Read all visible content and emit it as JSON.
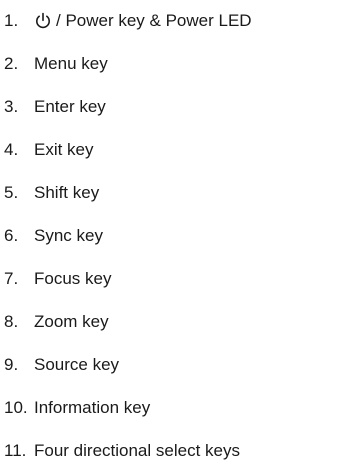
{
  "key_list": {
    "items": [
      {
        "number": "1.",
        "icon": "power-icon",
        "label": "/ Power key & Power LED"
      },
      {
        "number": "2.",
        "label": "Menu key"
      },
      {
        "number": "3.",
        "label": "Enter key"
      },
      {
        "number": "4.",
        "label": "Exit key"
      },
      {
        "number": "5.",
        "label": "Shift key"
      },
      {
        "number": "6.",
        "label": "Sync key"
      },
      {
        "number": "7.",
        "label": "Focus key"
      },
      {
        "number": "8.",
        "label": "Zoom key"
      },
      {
        "number": "9.",
        "label": "Source key"
      },
      {
        "number": "10.",
        "label": "Information key"
      },
      {
        "number": "11.",
        "label": "Four directional select keys"
      }
    ]
  }
}
